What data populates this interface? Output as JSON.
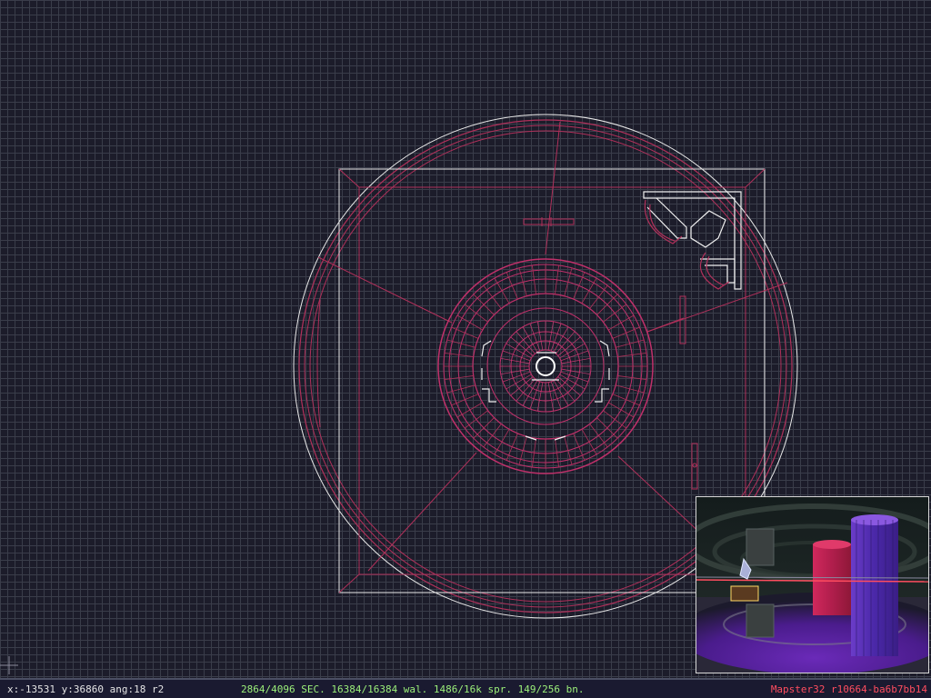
{
  "app": {
    "title": "Mapster32",
    "version": "Mapster32 r10664-ba6b7bb14"
  },
  "status": {
    "x": "-13531",
    "y": "36860",
    "ang": "18",
    "grid": "r2",
    "sectors": "2864/4096",
    "walls": "16384/16384",
    "sprites": "1486/16k",
    "bunches": "149/256",
    "coords_text": "x:-13531 y:36860 ang:18 r2",
    "stats_text": "2864/4096 SEC.  16384/16384 wal.  1486/16k spr.  149/256 bn."
  },
  "colors": {
    "background": "#1c1c2a",
    "grid": "#3a3d4a",
    "white_wall": "#e8e8e8",
    "red_wall": "#b0305a",
    "status_coords": "#e4e4e4",
    "status_stats": "#9cf07a",
    "status_version": "#ff4d5f"
  },
  "icons": {
    "cursor": "crosshair-icon"
  }
}
